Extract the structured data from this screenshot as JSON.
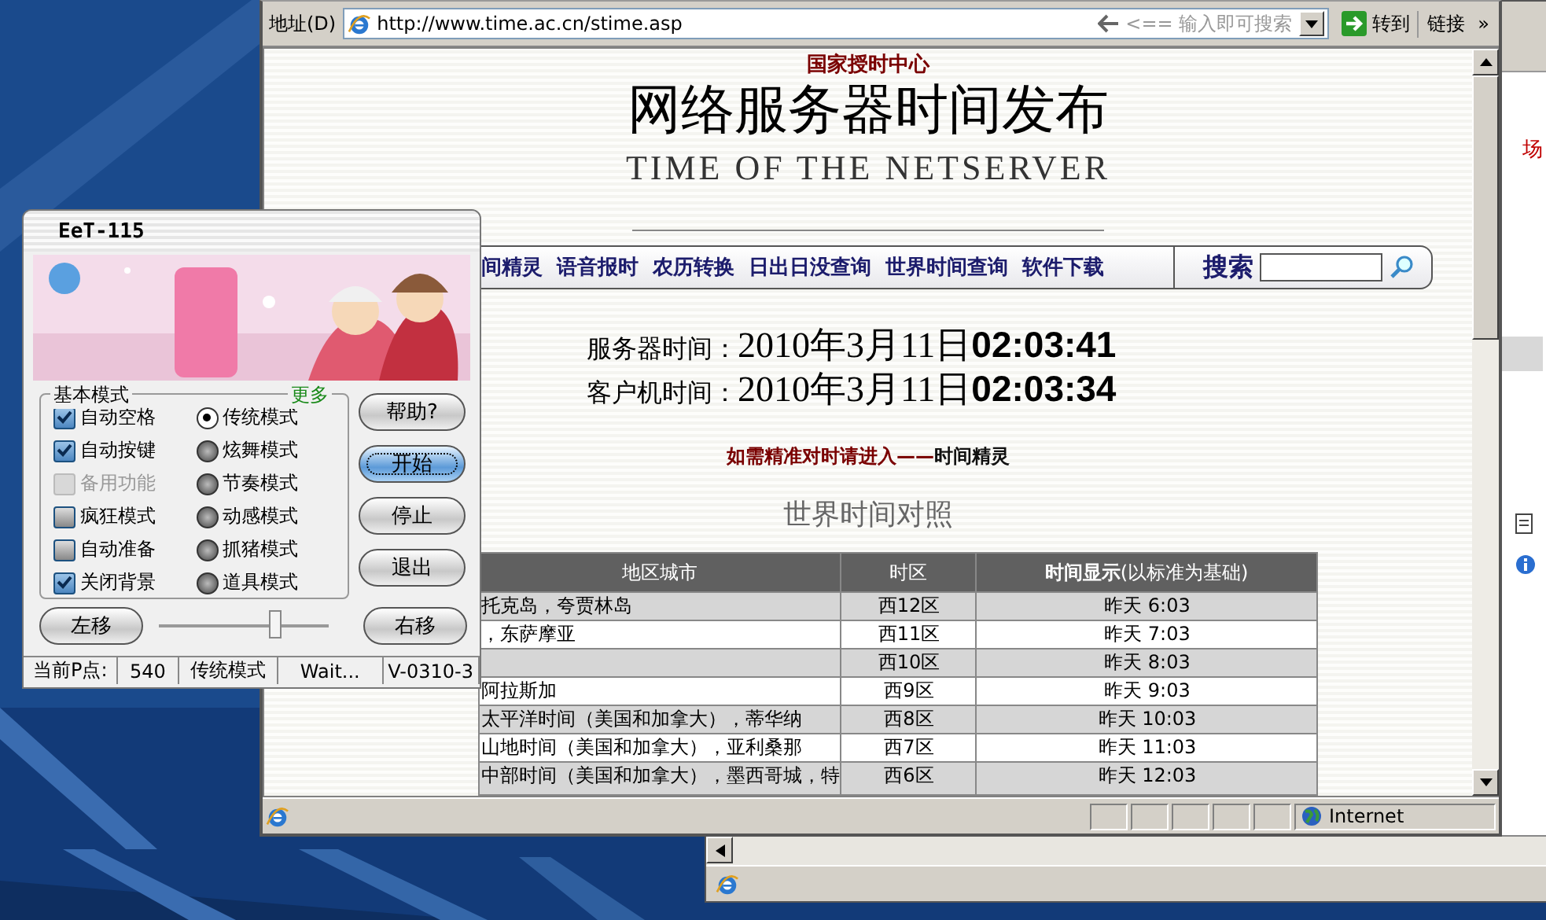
{
  "back_window": {
    "red_text": "场"
  },
  "browser": {
    "address_label": "地址(D)",
    "url": "http://www.time.ac.cn/stime.asp",
    "search_hint": "<== 输入即可搜索",
    "go_label": "转到",
    "links_label": "链接",
    "more_label": "»",
    "page": {
      "org": "国家授时中心",
      "title": "网络服务器时间发布",
      "subtitle": "TIME OF THE NETSERVER",
      "nav_links": [
        "间精灵",
        "语音报时",
        "农历转换",
        "日出日没查询",
        "世界时间查询",
        "软件下载"
      ],
      "search_label": "搜索",
      "times": [
        {
          "label": "服务器时间：",
          "value": "2010年3月11日**02:03:41**"
        },
        {
          "label": "客户机时间：",
          "value": "2010年3月11日**02:03:34**"
        }
      ],
      "prompt": "如需精准对时请进入——",
      "prompt_link": "时间精灵",
      "section_title": "世界时间对照",
      "table": {
        "columns": [
          "地区城市",
          "时区",
          "**时间显示**(以标准为基础)"
        ],
        "rows": [
          {
            "region": "托克岛，夸贾林岛",
            "zone": "西12区",
            "time": "昨天 6:03"
          },
          {
            "region": "，东萨摩亚",
            "zone": "西11区",
            "time": "昨天 7:03"
          },
          {
            "zone": "西10区",
            "time": "昨天 8:03"
          },
          {
            "region": "阿拉斯加",
            "zone": "西9区",
            "time": "昨天 9:03"
          },
          {
            "region": "太平洋时间（美国和加拿大），蒂华纳",
            "zone": "西8区",
            "time": "昨天 10:03"
          },
          {
            "region": "山地时间（美国和加拿大），亚利桑那",
            "zone": "西7区",
            "time": "昨天 11:03"
          },
          {
            "region": "中部时间（美国和加拿大），墨西哥城，特",
            "zone": "西6区",
            "time": "昨天 12:03"
          }
        ]
      }
    },
    "status_bar": {
      "zone": "Internet"
    }
  },
  "eet": {
    "title": "EeT-115",
    "group_title": "基本模式",
    "more": "更多",
    "checkboxes": [
      {
        "label": "自动空格",
        "checked": true,
        "disabled": false
      },
      {
        "label": "自动按键",
        "checked": true,
        "disabled": false
      },
      {
        "label": "备用功能",
        "checked": false,
        "disabled": true
      },
      {
        "label": "疯狂模式",
        "checked": false,
        "disabled": false
      },
      {
        "label": "自动准备",
        "checked": false,
        "disabled": false
      },
      {
        "label": "关闭背景",
        "checked": true,
        "disabled": false
      }
    ],
    "radios": [
      {
        "label": "传统模式",
        "selected": true
      },
      {
        "label": "炫舞模式",
        "selected": false
      },
      {
        "label": "节奏模式",
        "selected": false
      },
      {
        "label": "动感模式",
        "selected": false
      },
      {
        "label": "抓猪模式",
        "selected": false
      },
      {
        "label": "道具模式",
        "selected": false
      }
    ],
    "buttons": [
      {
        "label": "帮助?",
        "focused": false
      },
      {
        "label": "开始",
        "focused": true
      },
      {
        "label": "停止",
        "focused": false
      },
      {
        "label": "退出",
        "focused": false
      }
    ],
    "move_left": "左移",
    "move_right": "右移",
    "slider": {
      "level": 0.69
    },
    "status": [
      "当前P点:",
      "540",
      "传统模式",
      "Wait...",
      "V-0310-3"
    ]
  }
}
